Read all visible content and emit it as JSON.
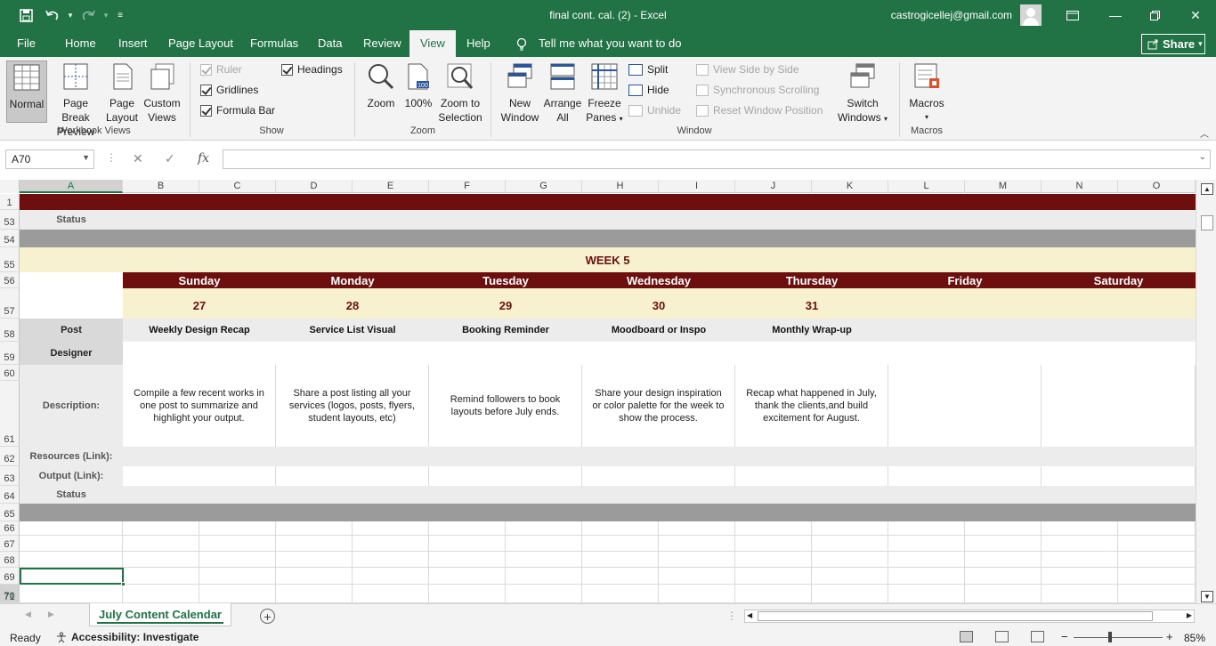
{
  "titlebar": {
    "doc_title": "final cont. cal. (2)  -  Excel",
    "user_email": "castrogicellej@gmail.com"
  },
  "tabs": [
    "File",
    "Home",
    "Insert",
    "Page Layout",
    "Formulas",
    "Data",
    "Review",
    "View",
    "Help"
  ],
  "active_tab": "View",
  "tell_me": "Tell me what you want to do",
  "share_label": "Share",
  "ribbon": {
    "workbook_views": {
      "group_label": "Workbook Views",
      "normal": "Normal",
      "page_break_1": "Page Break",
      "page_break_2": "Preview",
      "page_layout_1": "Page",
      "page_layout_2": "Layout",
      "custom_views_1": "Custom",
      "custom_views_2": "Views"
    },
    "show": {
      "group_label": "Show",
      "ruler": "Ruler",
      "gridlines": "Gridlines",
      "formula_bar": "Formula Bar",
      "headings": "Headings"
    },
    "zoom": {
      "group_label": "Zoom",
      "zoom": "Zoom",
      "hundred": "100%",
      "zoom_sel_1": "Zoom to",
      "zoom_sel_2": "Selection"
    },
    "window": {
      "group_label": "Window",
      "new_window_1": "New",
      "new_window_2": "Window",
      "arrange_1": "Arrange",
      "arrange_2": "All",
      "freeze_1": "Freeze",
      "freeze_2": "Panes",
      "split": "Split",
      "hide": "Hide",
      "unhide": "Unhide",
      "side_by_side": "View Side by Side",
      "sync_scroll": "Synchronous Scrolling",
      "reset_pos": "Reset Window Position",
      "switch_1": "Switch",
      "switch_2": "Windows"
    },
    "macros": {
      "group_label": "Macros",
      "macros": "Macros"
    }
  },
  "formula_bar": {
    "name_box": "A70",
    "fx": "fx",
    "cancel": "✕",
    "enter": "✓"
  },
  "columns": [
    "A",
    "B",
    "C",
    "D",
    "E",
    "F",
    "G",
    "H",
    "I",
    "J",
    "K",
    "L",
    "M",
    "N",
    "O"
  ],
  "selected_column": "A",
  "rows": [
    "1",
    "53",
    "54",
    "55",
    "56",
    "57",
    "58",
    "59",
    "60",
    "61",
    "62",
    "63",
    "64",
    "65",
    "66",
    "67",
    "68",
    "69",
    "70",
    "71"
  ],
  "selected_row": "70",
  "sheet": {
    "status_top": "Status",
    "week_title": "WEEK 5",
    "days": [
      "Sunday",
      "Monday",
      "Tuesday",
      "Wednesday",
      "Thursday",
      "Friday",
      "Saturday"
    ],
    "dates": [
      "27",
      "28",
      "29",
      "30",
      "31",
      "",
      ""
    ],
    "post_label": "Post",
    "posts": [
      "Weekly Design Recap",
      "Service List Visual",
      "Booking Reminder",
      "Moodboard or Inspo",
      "Monthly Wrap-up",
      "",
      ""
    ],
    "designer_label": "Designer",
    "description_label": "Description:",
    "descriptions": [
      "Compile a few recent works in one post to summarize and highlight your output.",
      "Share a post listing all your services (logos, posts, flyers, student layouts, etc)",
      "Remind followers to book layouts before July ends.",
      "Share your design inspiration or color palette for the week to show the process.",
      "Recap what happened in July, thank the clients,and build excitement for August.",
      "",
      ""
    ],
    "resources_label": "Resources (Link):",
    "output_label": "Output (Link):",
    "status_label": "Status"
  },
  "sheet_tab": "July Content Calendar",
  "statusbar": {
    "ready": "Ready",
    "accessibility": "Accessibility: Investigate",
    "zoom": "85%"
  },
  "colors": {
    "excel_green": "#217346",
    "maroon": "#6e0f0f",
    "cream": "#f8f1cf",
    "gray_band": "#9b9b9b",
    "light_gray": "#ececec"
  }
}
